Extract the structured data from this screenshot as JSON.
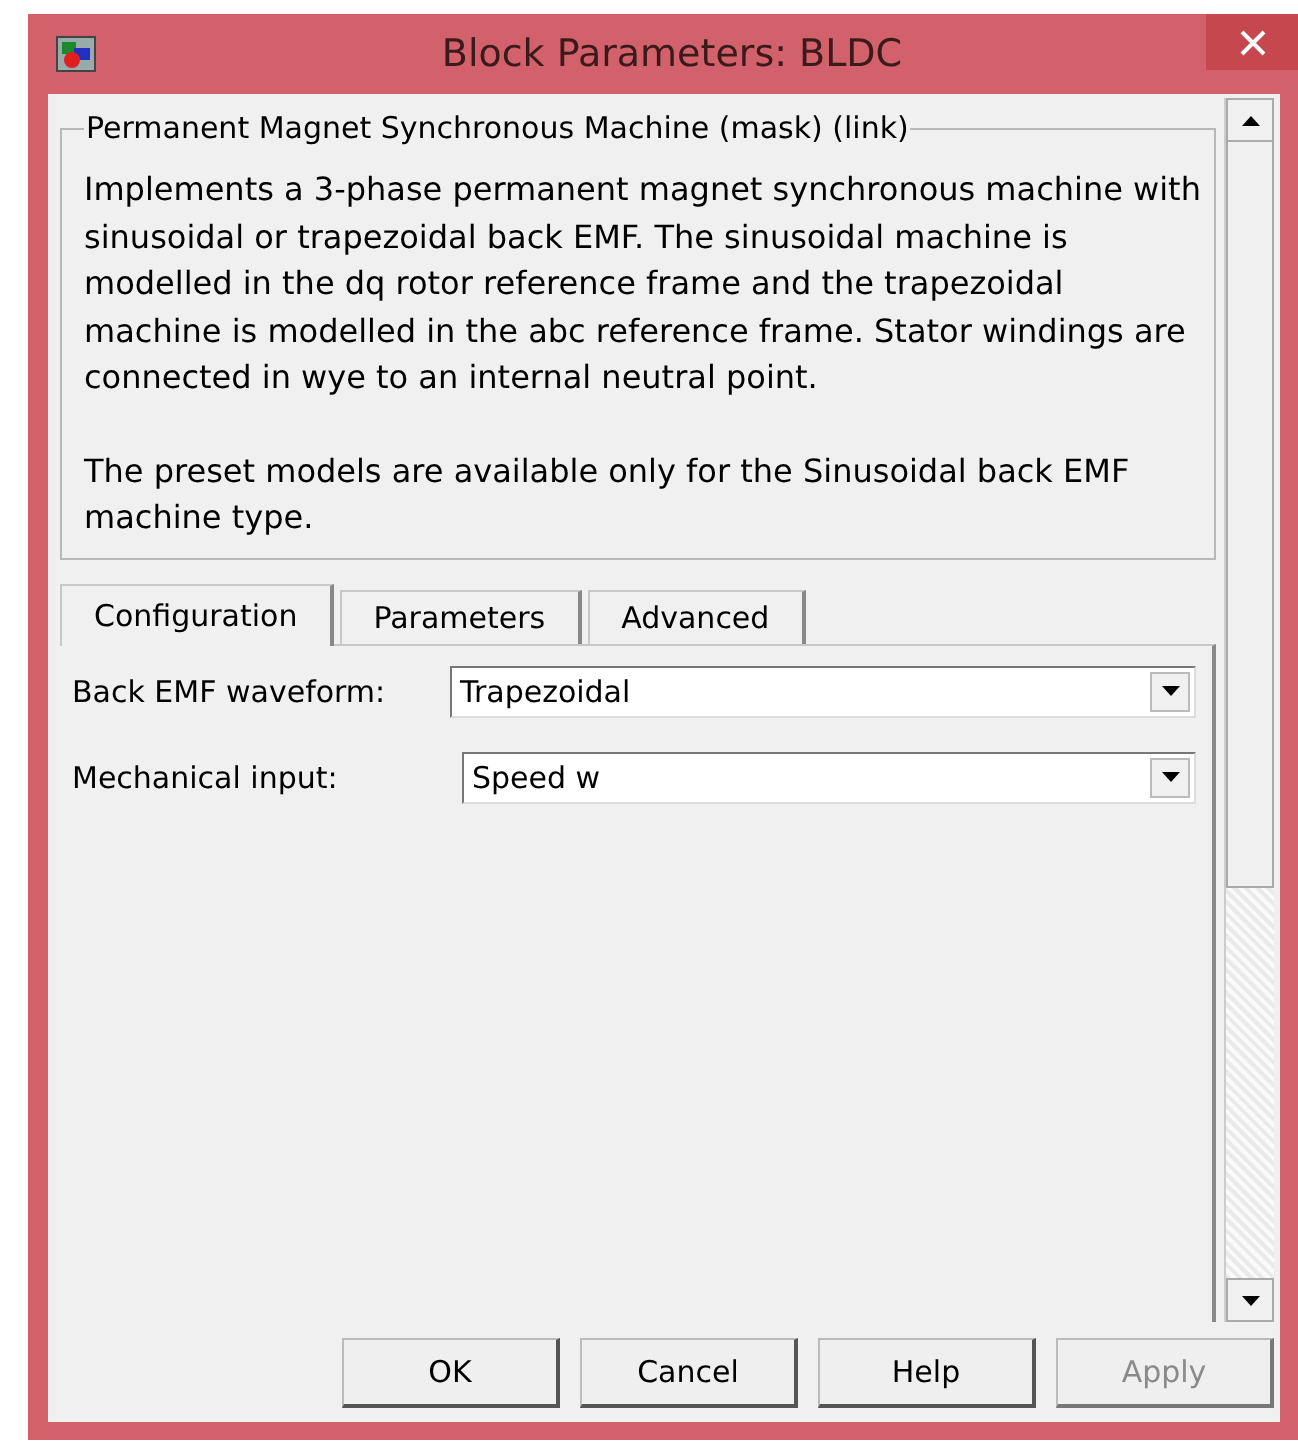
{
  "window": {
    "title": "Block Parameters: BLDC"
  },
  "group": {
    "legend": "Permanent Magnet Synchronous Machine (mask) (link)",
    "paragraphs": [
      "Implements a 3-phase permanent magnet synchronous machine with sinusoidal or trapezoidal back EMF. The sinusoidal machine is modelled in the dq rotor reference frame and the trapezoidal machine is modelled in the abc reference frame. Stator windings are connected in wye to an internal neutral point.",
      "The preset models are available only for the Sinusoidal back EMF machine type."
    ]
  },
  "tabs": [
    {
      "label": "Configuration",
      "selected": true
    },
    {
      "label": "Parameters",
      "selected": false
    },
    {
      "label": "Advanced",
      "selected": false
    }
  ],
  "fields": [
    {
      "label": "Back EMF waveform:",
      "value": "Trapezoidal"
    },
    {
      "label": "Mechanical input:",
      "value": "Speed w"
    }
  ],
  "buttons": [
    {
      "label": "OK",
      "disabled": false
    },
    {
      "label": "Cancel",
      "disabled": false
    },
    {
      "label": "Help",
      "disabled": false
    },
    {
      "label": "Apply",
      "disabled": true
    }
  ]
}
